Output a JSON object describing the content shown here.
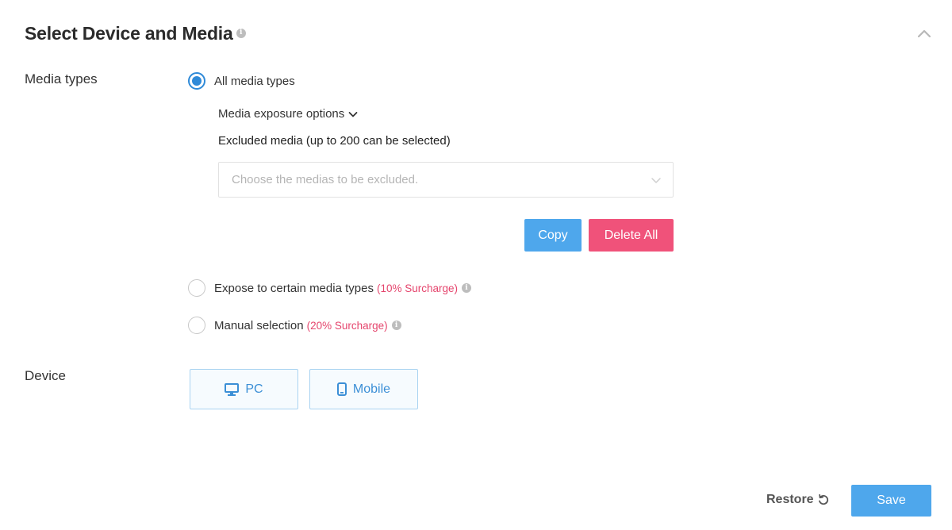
{
  "header": {
    "title": "Select Device and Media",
    "info_icon": "info-icon",
    "collapse_icon": "chevron-up-icon"
  },
  "media_types": {
    "label": "Media types",
    "options": [
      {
        "label": "All media types",
        "checked": true
      },
      {
        "label": "Expose to certain media types",
        "surcharge": "(10% Surcharge)",
        "checked": false
      },
      {
        "label": "Manual selection",
        "surcharge": "(20% Surcharge)",
        "checked": false
      }
    ],
    "exposure_options_label": "Media exposure options",
    "excluded_label": "Excluded media (up to 200 can be selected)",
    "excluded_placeholder": "Choose the medias to be excluded.",
    "copy_label": "Copy",
    "delete_all_label": "Delete All"
  },
  "device": {
    "label": "Device",
    "options": [
      {
        "label": "PC",
        "icon": "desktop-icon"
      },
      {
        "label": "Mobile",
        "icon": "mobile-icon"
      }
    ]
  },
  "footer": {
    "restore_label": "Restore",
    "save_label": "Save"
  },
  "colors": {
    "accent": "#2f8ad8",
    "button_blue": "#4ea7ec",
    "button_pink": "#f0527a",
    "surcharge": "#e5456d"
  }
}
